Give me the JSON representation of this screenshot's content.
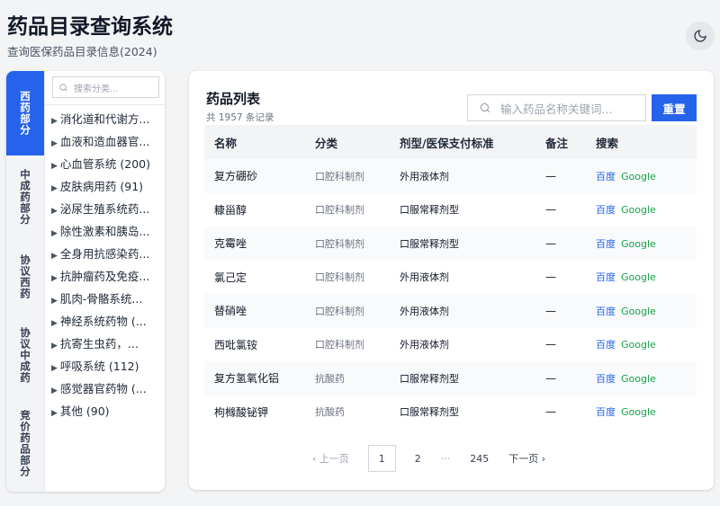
{
  "header": {
    "title": "药品目录查询系统",
    "subtitle": "查询医保药品目录信息(2024)",
    "theme_icon": "moon-icon"
  },
  "sidebar": {
    "tabs": [
      {
        "label": "西药部分",
        "active": true
      },
      {
        "label": "中成药部分"
      },
      {
        "label": "协议西药"
      },
      {
        "label": "协议中成药"
      },
      {
        "label": "竞价药品部分"
      }
    ],
    "search_placeholder": "搜索分类...",
    "categories": [
      "消化道和代谢方...",
      "血液和造血器官...",
      "心血管系统 (200)",
      "皮肤病用药 (91)",
      "泌尿生殖系统药...",
      "除性激素和胰岛...",
      "全身用抗感染药...",
      "抗肿瘤药及免疫...",
      "肌肉-骨骼系统...",
      "神经系统药物 (...",
      "抗寄生虫药，...",
      "呼吸系统 (112)",
      "感觉器官药物 (...",
      "其他 (90)"
    ]
  },
  "main": {
    "title": "药品列表",
    "count": "共 1957 条记录",
    "search_placeholder": "输入药品名称关键词...",
    "reset_label": "重置",
    "columns": [
      "名称",
      "分类",
      "剂型/医保支付标准",
      "备注",
      "搜索"
    ],
    "rows": [
      {
        "name": "复方硼砂",
        "category": "口腔科制剂",
        "form": "外用液体剂",
        "note": "—"
      },
      {
        "name": "糠甾醇",
        "category": "口腔科制剂",
        "form": "口服常释剂型",
        "note": "—"
      },
      {
        "name": "克霉唑",
        "category": "口腔科制剂",
        "form": "口服常释剂型",
        "note": "—"
      },
      {
        "name": "氯己定",
        "category": "口腔科制剂",
        "form": "外用液体剂",
        "note": "—"
      },
      {
        "name": "替硝唑",
        "category": "口腔科制剂",
        "form": "外用液体剂",
        "note": "—"
      },
      {
        "name": "西吡氯铵",
        "category": "口腔科制剂",
        "form": "外用液体剂",
        "note": "—"
      },
      {
        "name": "复方氢氧化铝",
        "category": "抗酸药",
        "form": "口服常释剂型",
        "note": "—"
      },
      {
        "name": "枸橼酸铋钾",
        "category": "抗酸药",
        "form": "口服常释剂型",
        "note": "—"
      }
    ],
    "link_baidu": "百度",
    "link_google": "Google",
    "pagination": {
      "prev": "‹ 上一页",
      "pages": [
        "1",
        "2",
        "···",
        "245"
      ],
      "current": "1",
      "next": "下一页 ›"
    }
  },
  "colors": {
    "accent": "#2563eb",
    "google": "#16a34a"
  }
}
